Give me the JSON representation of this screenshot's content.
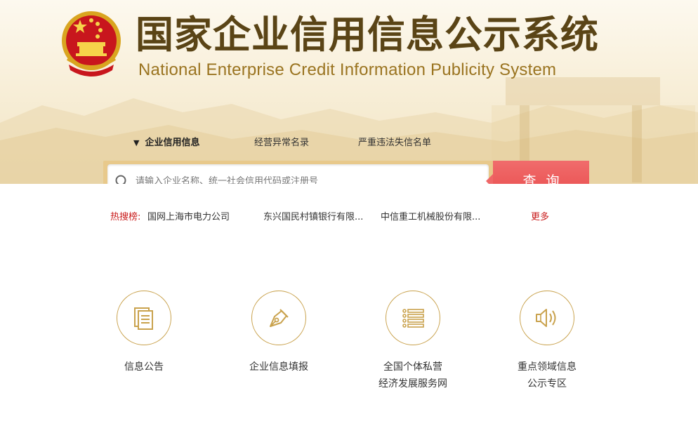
{
  "header": {
    "title_cn": "国家企业信用信息公示系统",
    "title_en": "National Enterprise Credit Information Publicity System",
    "emblem_icon": "national-emblem-icon"
  },
  "tabs": [
    {
      "label": "企业信用信息",
      "active": true,
      "marker": "▼"
    },
    {
      "label": "经营异常名录",
      "active": false
    },
    {
      "label": "严重违法失信名单",
      "active": false
    }
  ],
  "search": {
    "placeholder": "请输入企业名称、统一社会信用代码或注册号",
    "value": "",
    "button_label": "查询",
    "icon": "search-icon"
  },
  "hot_search": {
    "label": "热搜榜:",
    "items": [
      "国网上海市电力公司",
      "东兴国民村镇银行有限...",
      "中信重工机械股份有限..."
    ],
    "more_label": "更多"
  },
  "services": [
    {
      "label": "信息公告",
      "icon": "document-icon"
    },
    {
      "label": "企业信息填报",
      "icon": "pen-nib-icon"
    },
    {
      "label_line1": "全国个体私营",
      "label_line2": "经济发展服务网",
      "icon": "list-icon"
    },
    {
      "label_line1": "重点领域信息",
      "label_line2": "公示专区",
      "icon": "speaker-icon"
    }
  ],
  "colors": {
    "brand_brown": "#5a4416",
    "gold": "#c9a24d",
    "search_red": "#e94b4b",
    "hot_red": "#c91c1c"
  }
}
